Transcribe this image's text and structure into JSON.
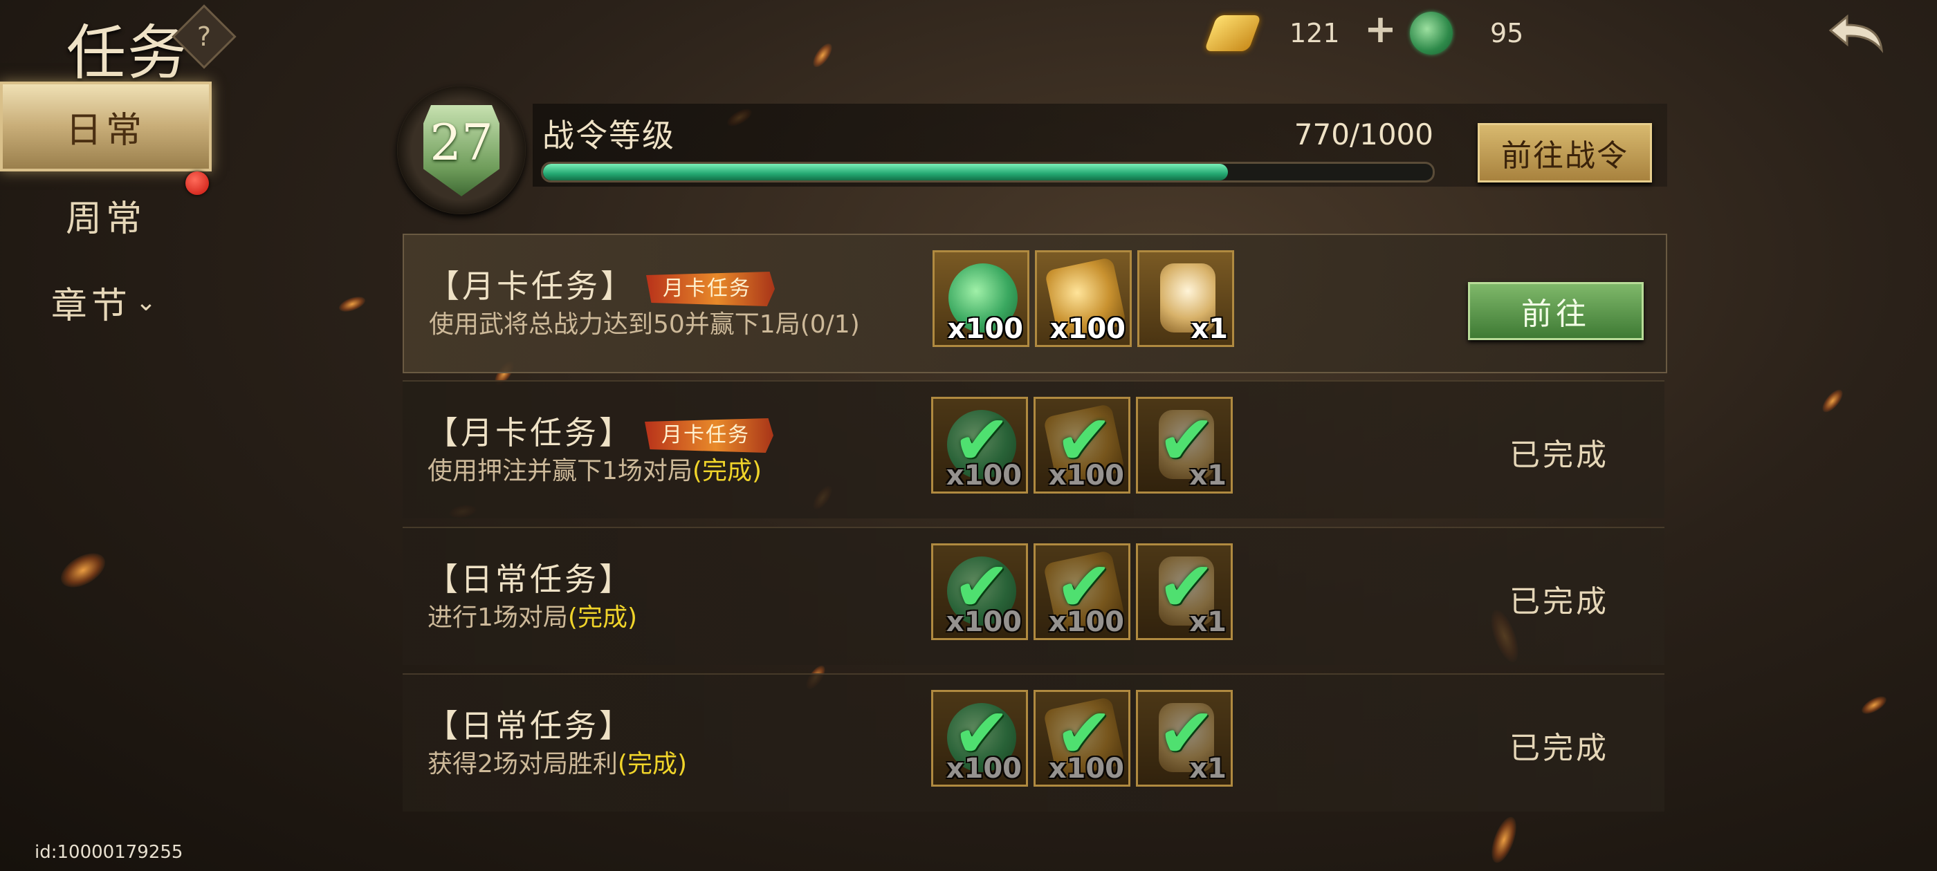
{
  "header": {
    "title": "任务",
    "help_label": "?",
    "gold_amount": "121",
    "add_label": "+",
    "jade_amount": "95"
  },
  "sidebar": {
    "tabs": [
      {
        "label": "日常"
      },
      {
        "label": "周常"
      },
      {
        "label": "章节"
      }
    ]
  },
  "battle_pass": {
    "level": "27",
    "label": "战令等级",
    "progress_text": "770/1000",
    "progress_fraction": 0.77,
    "goto_button": "前往战令"
  },
  "tasks": [
    {
      "title": "【月卡任务】",
      "tag": "月卡任务",
      "desc": "使用武将总战力达到50并赢下1局(0/1)",
      "rewards": [
        {
          "icon": "jade-icon",
          "qty": "x100"
        },
        {
          "icon": "token-icon",
          "qty": "x100"
        },
        {
          "icon": "card-icon",
          "qty": "x1"
        }
      ],
      "action": "前往"
    },
    {
      "title": "【月卡任务】",
      "tag": "月卡任务",
      "desc": "使用押注并赢下1场对局",
      "status_suffix": "(完成)",
      "rewards": [
        {
          "icon": "jade-icon",
          "qty": "x100"
        },
        {
          "icon": "token-icon",
          "qty": "x100"
        },
        {
          "icon": "card-icon",
          "qty": "x1"
        }
      ],
      "action": "已完成"
    },
    {
      "title": "【日常任务】",
      "desc": "进行1场对局",
      "status_suffix": "(完成)",
      "rewards": [
        {
          "icon": "jade-icon",
          "qty": "x100"
        },
        {
          "icon": "token-icon",
          "qty": "x100"
        },
        {
          "icon": "card-icon",
          "qty": "x1"
        }
      ],
      "action": "已完成"
    },
    {
      "title": "【日常任务】",
      "desc": "获得2场对局胜利",
      "status_suffix": "(完成)",
      "rewards": [
        {
          "icon": "jade-icon",
          "qty": "x100"
        },
        {
          "icon": "token-icon",
          "qty": "x100"
        },
        {
          "icon": "card-icon",
          "qty": "x1"
        }
      ],
      "action": "已完成"
    }
  ],
  "footer": {
    "uid": "id:10000179255"
  },
  "colors": {
    "accent_gold": "#c8ad78",
    "progress_green": "#24a872",
    "done_yellow": "#f0d42a"
  }
}
